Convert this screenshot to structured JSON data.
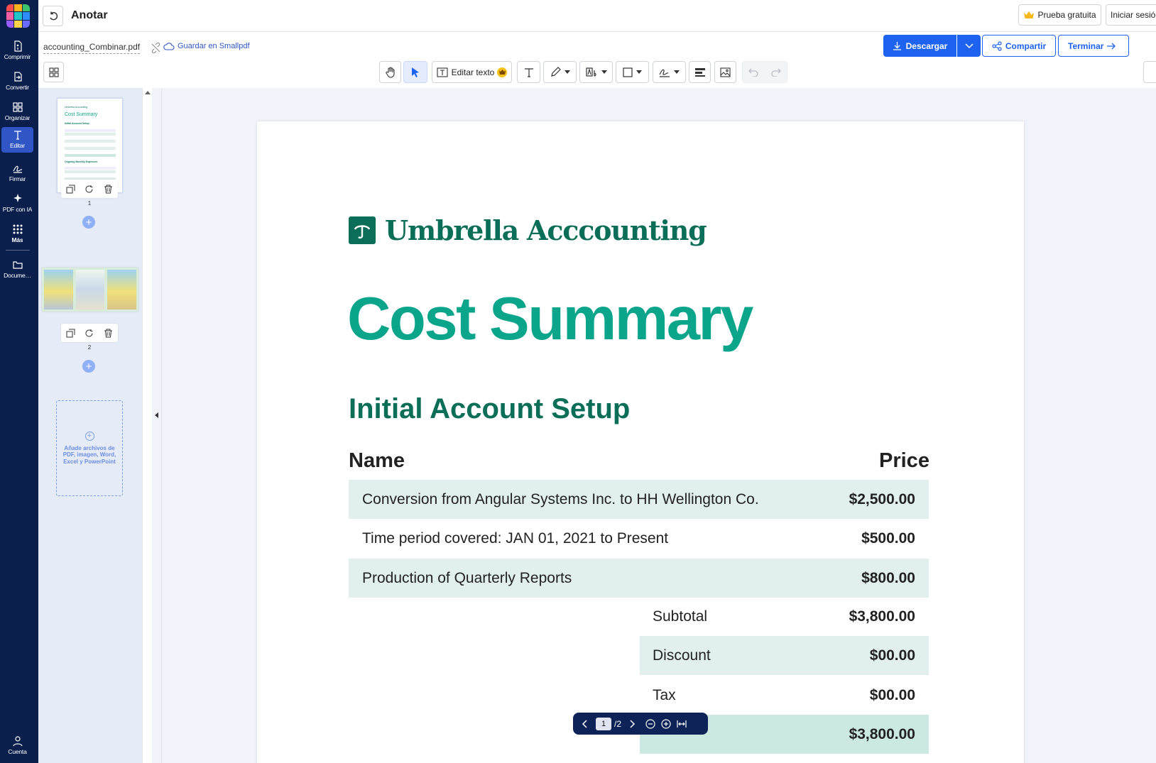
{
  "rail": {
    "items": [
      {
        "label": "Comprimir",
        "icon": "compress-icon"
      },
      {
        "label": "Convertir",
        "icon": "convert-icon"
      },
      {
        "label": "Organizar",
        "icon": "organize-icon"
      },
      {
        "label": "Editar",
        "icon": "edit-text-icon",
        "active": true
      },
      {
        "label": "Firmar",
        "icon": "sign-icon"
      },
      {
        "label": "PDF con IA",
        "icon": "ai-sparkle-icon"
      },
      {
        "label": "Más",
        "icon": "apps-grid-icon"
      },
      {
        "label": "Docume…",
        "icon": "folder-icon"
      },
      {
        "label": "Cuenta",
        "icon": "account-icon"
      }
    ],
    "logo_colors": [
      "#ff4d4d",
      "#ffb21d",
      "#3cc26a",
      "#2f8cff",
      "#9a5cff",
      "#ff5fa2",
      "#22c6c6",
      "#ffd24c",
      "#6a6cff"
    ]
  },
  "header": {
    "title": "Anotar",
    "trial_label": "Prueba gratuita",
    "login_label": "Iniciar sesión"
  },
  "file": {
    "name": "accounting_Combinar.pdf",
    "save_label": "Guardar en Smallpdf"
  },
  "actions": {
    "download_label": "Descargar",
    "share_label": "Compartir",
    "finish_label": "Terminar"
  },
  "toolbar": {
    "edit_text_label": "Editar texto",
    "tools": [
      "hand-icon",
      "pointer-icon",
      "edit-text-icon",
      "text-icon",
      "pen-icon",
      "text-style-icon",
      "shape-icon",
      "signature-icon",
      "redact-icon",
      "image-icon",
      "undo-icon",
      "redo-icon"
    ]
  },
  "thumbnails": {
    "pages": [
      {
        "number": "1",
        "mini_brand": "Umbrella Accounting",
        "mini_title": "Cost Summary",
        "mini_section_1": "Initial Account Setup",
        "mini_section_2": "Ongoing Monthly Expenses"
      },
      {
        "number": "2"
      }
    ],
    "add_files_text": "Añade archivos de PDF, imagen, Word, Excel y PowerPoint"
  },
  "document": {
    "brand": "Umbrella Acccounting",
    "title": "Cost Summary",
    "section": "Initial Account Setup",
    "columns": {
      "name": "Name",
      "price": "Price"
    },
    "rows": [
      {
        "name": "Conversion from Angular Systems Inc. to HH Wellington Co.",
        "price": "$2,500.00"
      },
      {
        "name": "Time period covered: JAN 01, 2021 to Present",
        "price": "$500.00"
      },
      {
        "name": "Production of Quarterly Reports",
        "price": "$800.00"
      }
    ],
    "summary": [
      {
        "name": "Subtotal",
        "price": "$3,800.00"
      },
      {
        "name": "Discount",
        "price": "$00.00"
      },
      {
        "name": "Tax",
        "price": "$00.00"
      },
      {
        "name": "",
        "price": "$3,800.00"
      }
    ]
  },
  "pager": {
    "current": "1",
    "total": "/2"
  },
  "colors": {
    "rail_bg": "#0b1f4d",
    "primary": "#1e63f0",
    "brand_green": "#0b6e58",
    "title_teal": "#0aa58b",
    "row_tint": "#e2f0ed"
  }
}
